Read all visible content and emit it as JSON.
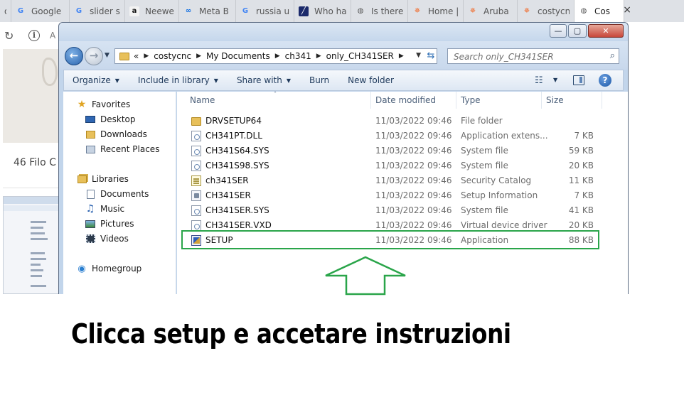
{
  "browser": {
    "tabs": [
      {
        "label": "or",
        "icon": "none",
        "color": "#dee1e6"
      },
      {
        "label": "Google",
        "icon": "google-translate-icon",
        "color": "#4285f4"
      },
      {
        "label": "slider s",
        "icon": "google-icon",
        "color": "#4285f4"
      },
      {
        "label": "Neewe",
        "icon": "amazon-icon",
        "color": "#111111"
      },
      {
        "label": "Meta B",
        "icon": "meta-icon",
        "color": "#0668e1"
      },
      {
        "label": "russia u",
        "icon": "google-icon",
        "color": "#4285f4"
      },
      {
        "label": "Who ha",
        "icon": "news-icon",
        "color": "#1b2a6b"
      },
      {
        "label": "Is there",
        "icon": "globe-icon",
        "color": "#555555"
      },
      {
        "label": "Home |",
        "icon": "aruba-icon",
        "color": "#f26522"
      },
      {
        "label": "Aruba",
        "icon": "aruba-icon",
        "color": "#f26522"
      },
      {
        "label": "costycn",
        "icon": "aruba-icon",
        "color": "#f26522"
      },
      {
        "label": "Cos",
        "icon": "globe-icon",
        "color": "#555555"
      }
    ],
    "close_glyph": "×",
    "address_stub": "A"
  },
  "background_page": {
    "card_title": "46 Filo C"
  },
  "explorer": {
    "breadcrumb": [
      {
        "label": "«"
      },
      {
        "label": "costycnc"
      },
      {
        "label": "My Documents"
      },
      {
        "label": "ch341"
      },
      {
        "label": "only_CH341SER"
      }
    ],
    "search_placeholder": "Search only_CH341SER",
    "commands": [
      {
        "label": "Organize",
        "dropdown": true
      },
      {
        "label": "Include in library",
        "dropdown": true
      },
      {
        "label": "Share with",
        "dropdown": true
      },
      {
        "label": "Burn",
        "dropdown": false
      },
      {
        "label": "New folder",
        "dropdown": false
      }
    ],
    "nav": {
      "favorites": "Favorites",
      "desktop": "Desktop",
      "downloads": "Downloads",
      "recent": "Recent Places",
      "libraries": "Libraries",
      "documents": "Documents",
      "music": "Music",
      "pictures": "Pictures",
      "videos": "Videos",
      "homegroup": "Homegroup"
    },
    "columns": {
      "name": "Name",
      "date": "Date modified",
      "type": "Type",
      "size": "Size"
    },
    "files": [
      {
        "name": "DRVSETUP64",
        "date": "11/03/2022 09:46",
        "type": "File folder",
        "size": "",
        "icon": "folder-icon"
      },
      {
        "name": "CH341PT.DLL",
        "date": "11/03/2022 09:46",
        "type": "Application extens...",
        "size": "7 KB",
        "icon": "dll-file-icon"
      },
      {
        "name": "CH341S64.SYS",
        "date": "11/03/2022 09:46",
        "type": "System file",
        "size": "59 KB",
        "icon": "sys-file-icon"
      },
      {
        "name": "CH341S98.SYS",
        "date": "11/03/2022 09:46",
        "type": "System file",
        "size": "20 KB",
        "icon": "sys-file-icon"
      },
      {
        "name": "ch341SER",
        "date": "11/03/2022 09:46",
        "type": "Security Catalog",
        "size": "11 KB",
        "icon": "catalog-file-icon"
      },
      {
        "name": "CH341SER",
        "date": "11/03/2022 09:46",
        "type": "Setup Information",
        "size": "7 KB",
        "icon": "inf-file-icon"
      },
      {
        "name": "CH341SER.SYS",
        "date": "11/03/2022 09:46",
        "type": "System file",
        "size": "41 KB",
        "icon": "sys-file-icon"
      },
      {
        "name": "CH341SER.VXD",
        "date": "11/03/2022 09:46",
        "type": "Virtual device driver",
        "size": "20 KB",
        "icon": "vxd-file-icon"
      },
      {
        "name": "SETUP",
        "date": "11/03/2022 09:46",
        "type": "Application",
        "size": "88 KB",
        "icon": "setup-app-icon"
      }
    ]
  },
  "annotation": {
    "highlight_color": "#2aa54a",
    "caption": "Clicca setup e accetare instruzioni"
  }
}
